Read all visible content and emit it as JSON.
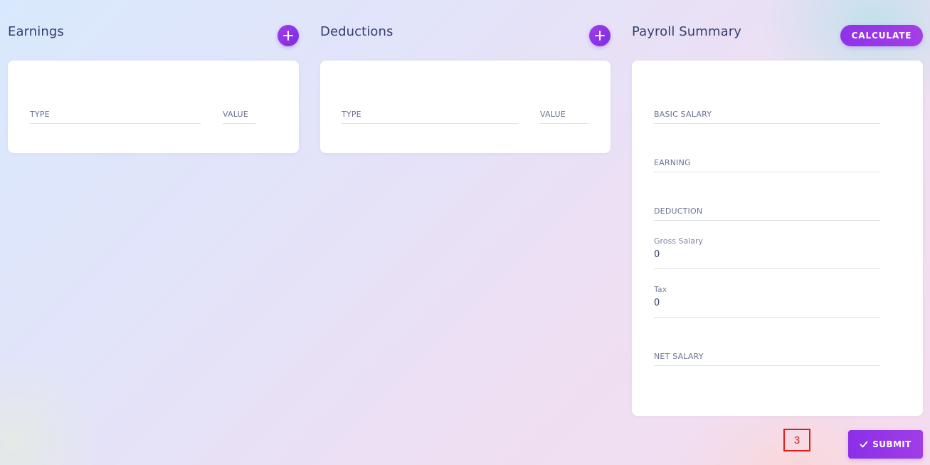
{
  "earnings": {
    "title": "Earnings",
    "columns": {
      "type": "TYPE",
      "value": "VALUE"
    }
  },
  "deductions": {
    "title": "Deductions",
    "columns": {
      "type": "TYPE",
      "value": "VALUE"
    }
  },
  "summary": {
    "title": "Payroll Summary",
    "calculate_label": "CALCULATE",
    "fields": {
      "basic_salary": {
        "label": "BASIC SALARY"
      },
      "earning": {
        "label": "EARNING"
      },
      "deduction": {
        "label": "DEDUCTION"
      },
      "gross_salary": {
        "label": "Gross Salary",
        "value": "0"
      },
      "tax": {
        "label": "Tax",
        "value": "0"
      },
      "net_salary": {
        "label": "NET SALARY"
      }
    }
  },
  "submit": {
    "label": "SUBMIT",
    "icon": "check-icon"
  },
  "marker": {
    "label": "3"
  },
  "colors": {
    "accent": "#8f32e8",
    "title": "#343e6e",
    "label": "#6c7294",
    "marker": "#e31c1c"
  }
}
